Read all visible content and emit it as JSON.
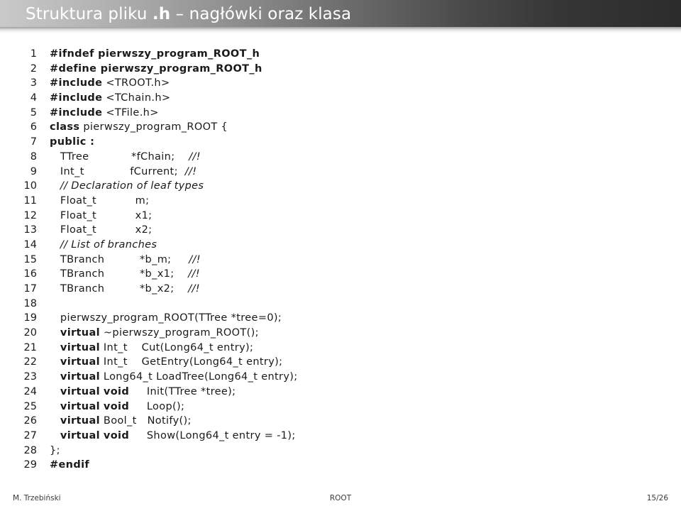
{
  "slide": {
    "title_prefix": "Struktura pliku ",
    "title_bold": ".h",
    "title_suffix": " – nagłówki oraz klasa"
  },
  "code": {
    "language": "cpp",
    "lines": [
      {
        "n": "1",
        "text": "#ifndef pierwszy_program_ROOT_h",
        "style": "kw"
      },
      {
        "n": "2",
        "text": "#define pierwszy_program_ROOT_h",
        "style": "kw"
      },
      {
        "n": "3",
        "text": "#include <TROOT.h>",
        "style": "kw-partial"
      },
      {
        "n": "4",
        "text": "#include <TChain.h>",
        "style": "kw-partial"
      },
      {
        "n": "5",
        "text": "#include <TFile.h>",
        "style": "kw-partial"
      },
      {
        "n": "6",
        "text": "class pierwszy_program_ROOT {",
        "style": "kw-partial"
      },
      {
        "n": "7",
        "text": "public :",
        "style": "kw"
      },
      {
        "n": "8",
        "text": "   TTree            *fChain;    //!",
        "style": "plain"
      },
      {
        "n": "9",
        "text": "   Int_t             fCurrent;  //!",
        "style": "plain"
      },
      {
        "n": "10",
        "text": "   // Declaration of leaf types",
        "style": "cmt"
      },
      {
        "n": "11",
        "text": "   Float_t           m;",
        "style": "plain"
      },
      {
        "n": "12",
        "text": "   Float_t           x1;",
        "style": "plain"
      },
      {
        "n": "13",
        "text": "   Float_t           x2;",
        "style": "plain"
      },
      {
        "n": "14",
        "text": "   // List of branches",
        "style": "cmt"
      },
      {
        "n": "15",
        "text": "   TBranch          *b_m;     //!",
        "style": "plain"
      },
      {
        "n": "16",
        "text": "   TBranch          *b_x1;    //!",
        "style": "plain"
      },
      {
        "n": "17",
        "text": "   TBranch          *b_x2;    //!",
        "style": "plain"
      },
      {
        "n": "18",
        "text": "",
        "style": "plain"
      },
      {
        "n": "19",
        "text": "   pierwszy_program_ROOT(TTree *tree=0);",
        "style": "plain"
      },
      {
        "n": "20",
        "text": "   virtual ~pierwszy_program_ROOT();",
        "style": "kw-partial"
      },
      {
        "n": "21",
        "text": "   virtual Int_t    Cut(Long64_t entry);",
        "style": "kw-partial"
      },
      {
        "n": "22",
        "text": "   virtual Int_t    GetEntry(Long64_t entry);",
        "style": "kw-partial"
      },
      {
        "n": "23",
        "text": "   virtual Long64_t LoadTree(Long64_t entry);",
        "style": "kw-partial"
      },
      {
        "n": "24",
        "text": "   virtual void     Init(TTree *tree);",
        "style": "kw-partial"
      },
      {
        "n": "25",
        "text": "   virtual void     Loop();",
        "style": "kw-partial"
      },
      {
        "n": "26",
        "text": "   virtual Bool_t   Notify();",
        "style": "kw-partial"
      },
      {
        "n": "27",
        "text": "   virtual void     Show(Long64_t entry = -1);",
        "style": "kw-partial"
      },
      {
        "n": "28",
        "text": "};",
        "style": "plain"
      },
      {
        "n": "29",
        "text": "#endif",
        "style": "kw"
      }
    ]
  },
  "footer": {
    "author": "M. Trzebiński",
    "topic": "ROOT",
    "page": "15/26"
  },
  "colors": {
    "header_light": "#c9c9c9",
    "header_dark": "#2c2c2c",
    "title_text": "#ffffff",
    "code_text": "#1a1a1a",
    "footer_text": "#3a3a3a",
    "background": "#ffffff"
  }
}
